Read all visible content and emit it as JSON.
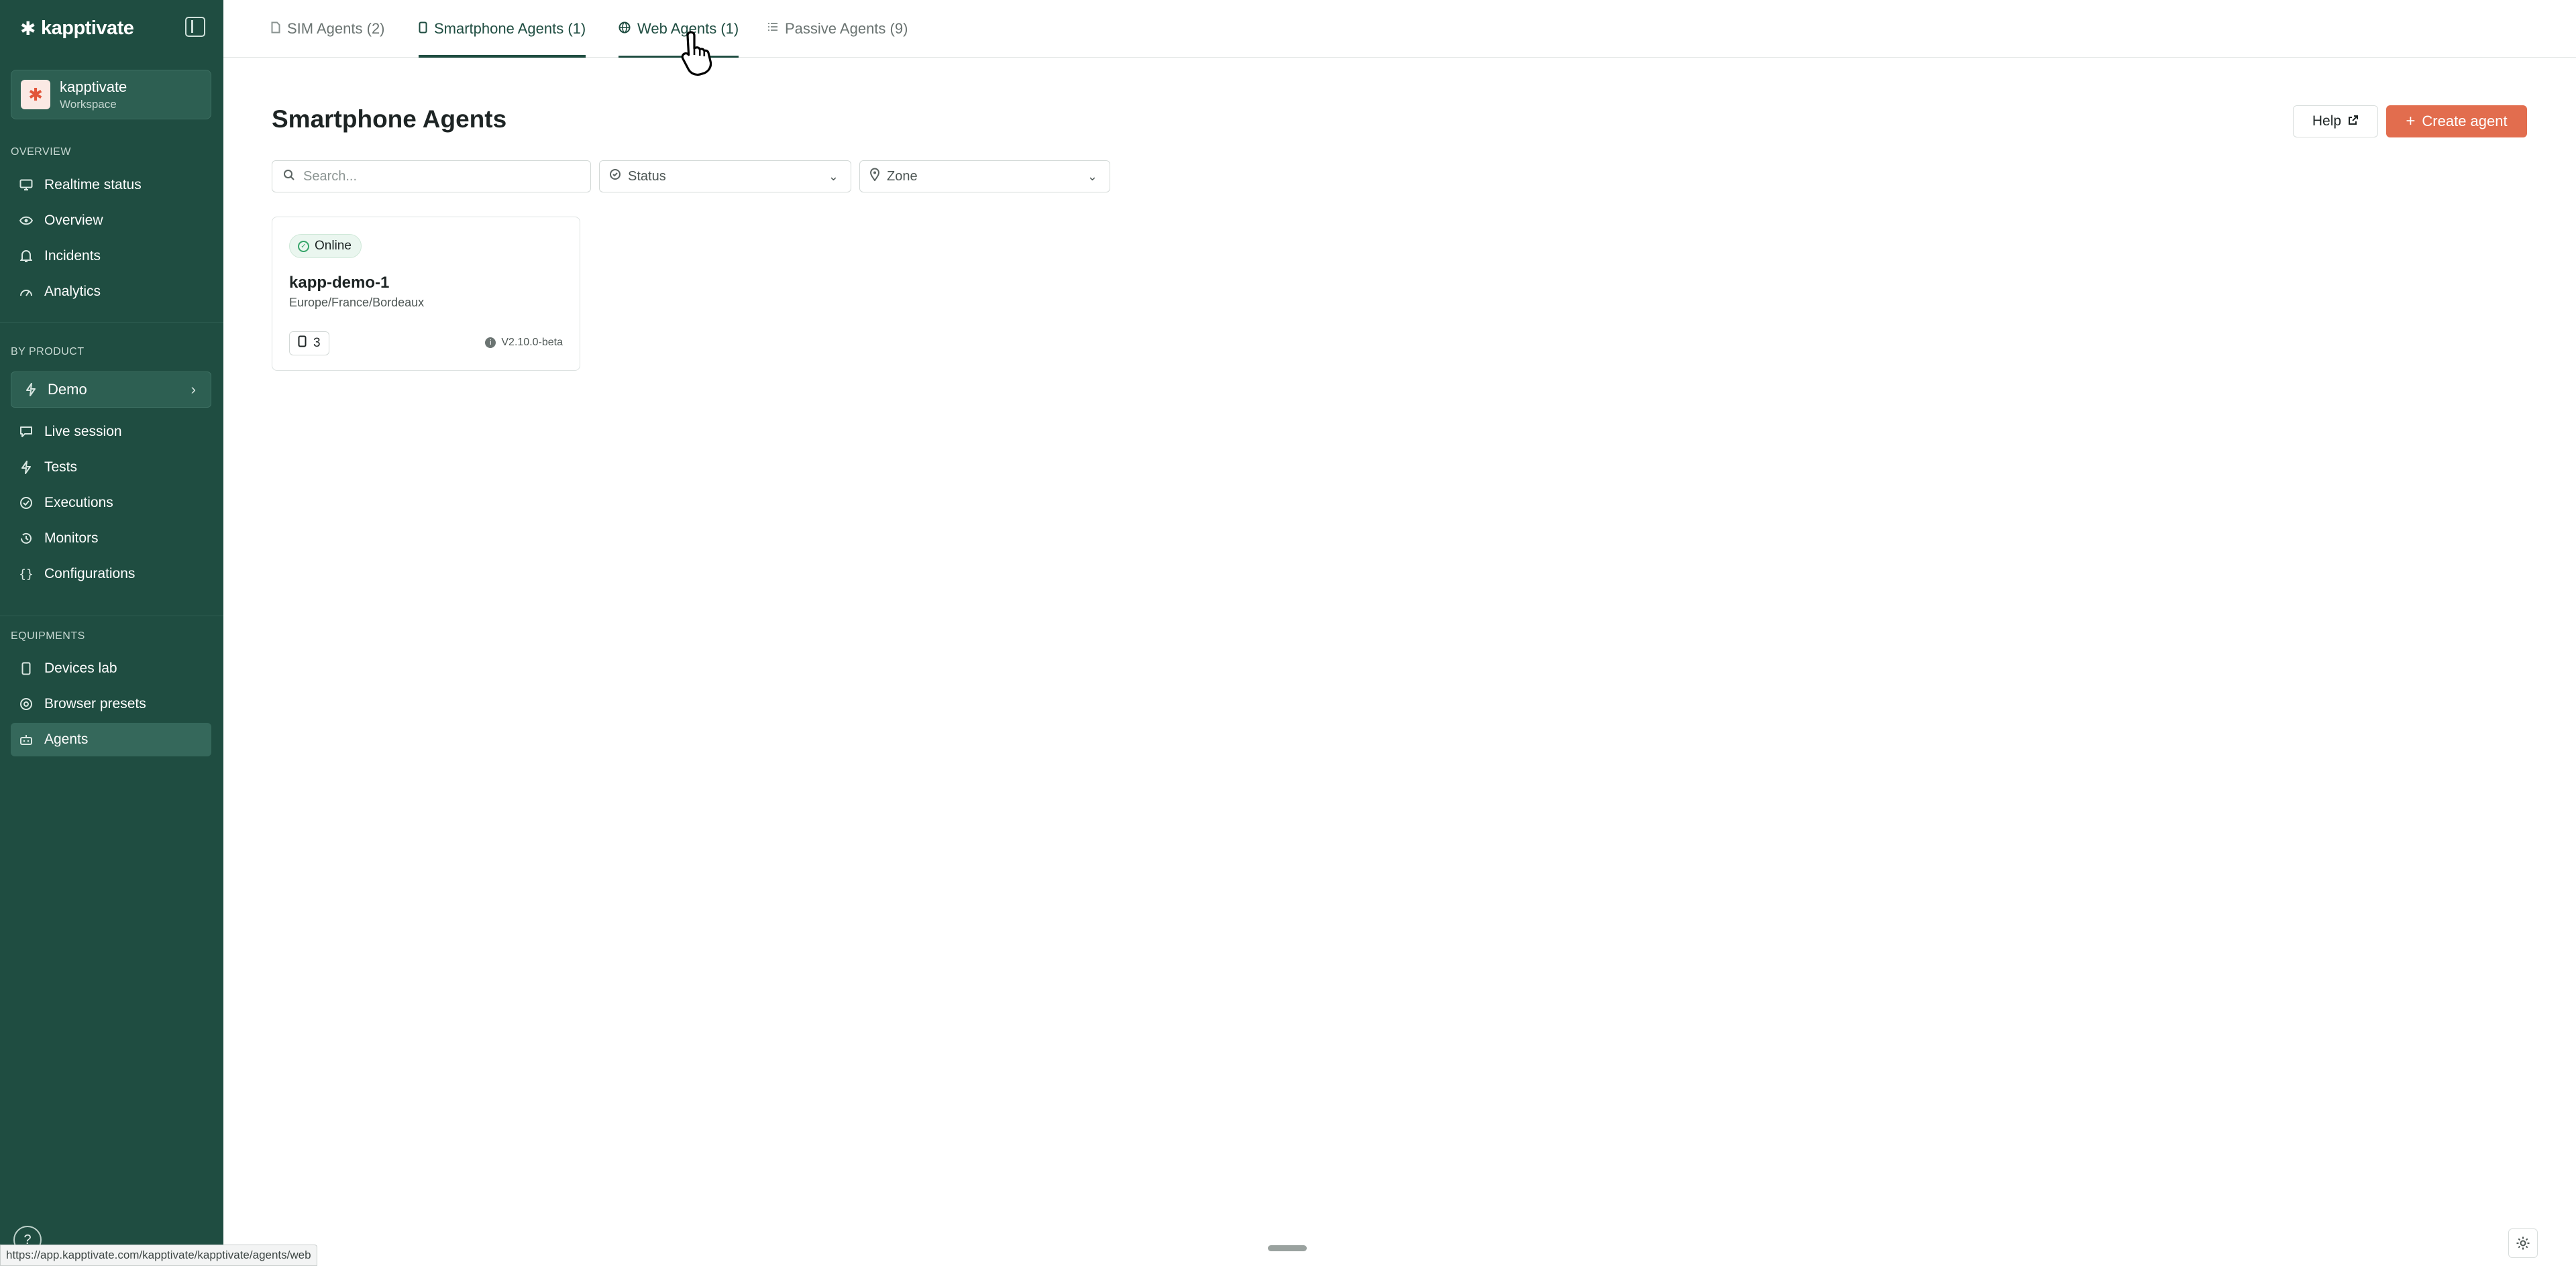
{
  "brand": {
    "name": "kapptivate",
    "logo_icon": "asterisk-icon"
  },
  "workspace": {
    "name": "kapptivate",
    "subtitle": "Workspace",
    "logo_glyph": "✱"
  },
  "sidebar": {
    "overview_label": "OVERVIEW",
    "overview_items": [
      {
        "label": "Realtime status",
        "icon": "monitor-icon"
      },
      {
        "label": "Overview",
        "icon": "eye-icon"
      },
      {
        "label": "Incidents",
        "icon": "bell-icon"
      },
      {
        "label": "Analytics",
        "icon": "gauge-icon"
      }
    ],
    "by_product_label": "BY PRODUCT",
    "product_select": {
      "label": "Demo"
    },
    "product_items": [
      {
        "label": "Live session",
        "icon": "chat-icon"
      },
      {
        "label": "Tests",
        "icon": "bolt-icon"
      },
      {
        "label": "Executions",
        "icon": "check-circle-icon"
      },
      {
        "label": "Monitors",
        "icon": "history-icon"
      },
      {
        "label": "Configurations",
        "icon": "braces-icon"
      }
    ],
    "equipments_label": "EQUIPMENTS",
    "equipment_items": [
      {
        "label": "Devices lab",
        "icon": "smartphone-icon"
      },
      {
        "label": "Browser presets",
        "icon": "chrome-icon"
      },
      {
        "label": "Agents",
        "icon": "robot-icon",
        "active": true
      }
    ],
    "help_glyph": "?"
  },
  "tabs": [
    {
      "label": "SIM Agents (2)",
      "icon": "sim-icon"
    },
    {
      "label": "Smartphone Agents (1)",
      "icon": "smartphone-icon",
      "active": true
    },
    {
      "label": "Web Agents (1)",
      "icon": "globe-icon",
      "hover": true
    },
    {
      "label": "Passive Agents (9)",
      "icon": "list-icon"
    }
  ],
  "main": {
    "title": "Smartphone Agents",
    "help_label": "Help",
    "create_label": "Create agent",
    "search_placeholder": "Search...",
    "status_filter": "Status",
    "zone_filter": "Zone"
  },
  "agents": [
    {
      "status": "Online",
      "name": "kapp-demo-1",
      "zone": "Europe/France/Bordeaux",
      "device_count": "3",
      "version": "V2.10.0-beta"
    }
  ],
  "status_bar": {
    "url": "https://app.kapptivate.com/kapptivate/kapptivate/agents/web"
  },
  "colors": {
    "sidebar_bg": "#1f4d41",
    "accent": "#e26d4e",
    "online": "#37a56a"
  }
}
